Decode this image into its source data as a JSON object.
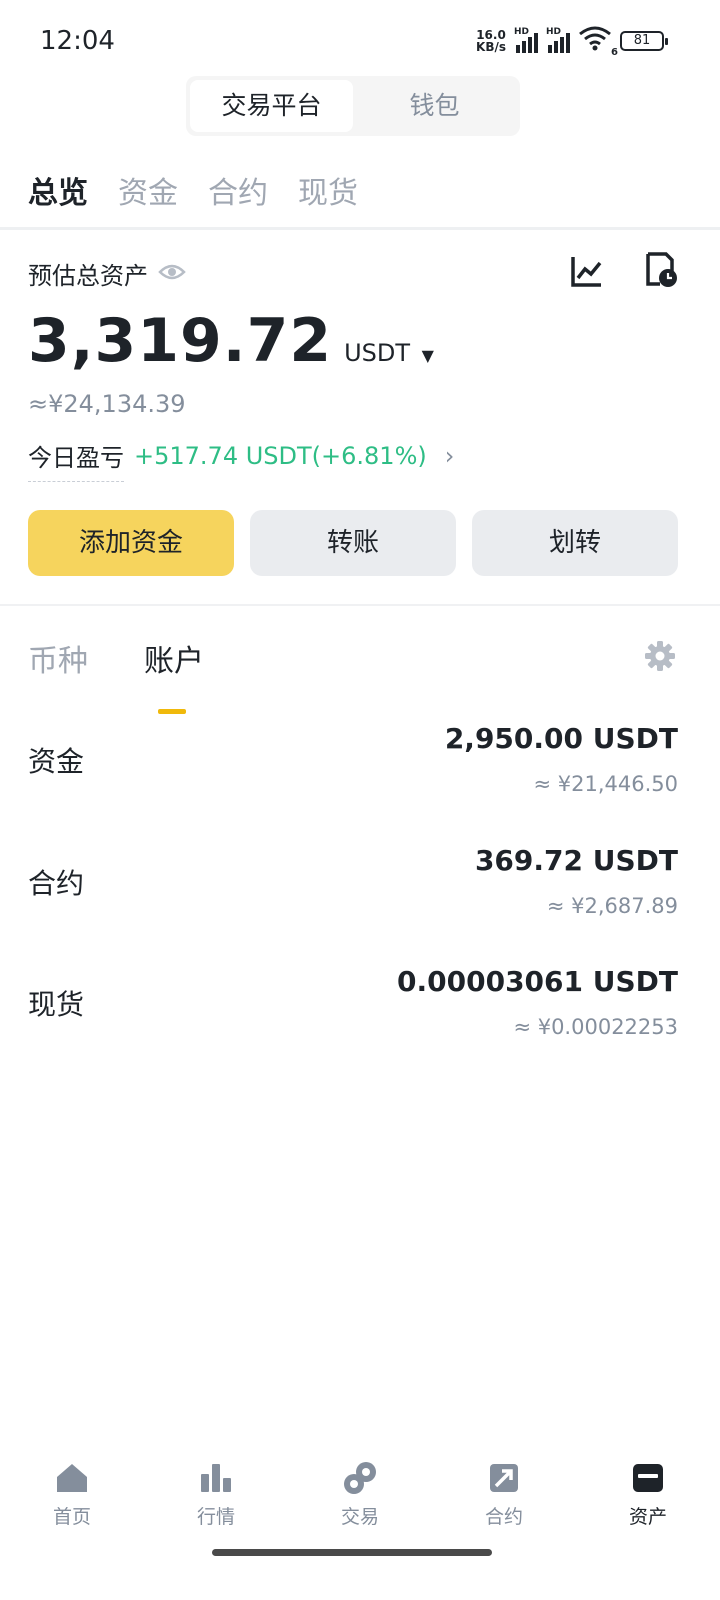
{
  "status_bar": {
    "time": "12:04",
    "net_speed_value": "16.0",
    "net_speed_unit": "KB/s",
    "hd": "HD",
    "wifi_badge": "6",
    "battery": "81"
  },
  "segment": {
    "items": [
      "交易平台",
      "钱包"
    ],
    "active": "交易平台"
  },
  "top_tabs": {
    "items": [
      "总览",
      "资金",
      "合约",
      "现货"
    ],
    "active": "总览"
  },
  "overview": {
    "label": "预估总资产",
    "balance": "3,319.72",
    "unit": "USDT",
    "fiat": "≈¥24,134.39",
    "pnl_label": "今日盈亏",
    "pnl_value": "+517.74 USDT(+6.81%)"
  },
  "actions": {
    "add_funds": "添加资金",
    "transfer": "转账",
    "internal_transfer": "划转"
  },
  "sub_tabs": {
    "items": [
      "币种",
      "账户"
    ],
    "active": "账户"
  },
  "accounts": [
    {
      "name": "资金",
      "value": "2,950.00 USDT",
      "fiat": "≈ ¥21,446.50"
    },
    {
      "name": "合约",
      "value": "369.72 USDT",
      "fiat": "≈ ¥2,687.89"
    },
    {
      "name": "现货",
      "value": "0.00003061 USDT",
      "fiat": "≈ ¥0.00022253"
    }
  ],
  "bottom_nav": {
    "items": [
      "首页",
      "行情",
      "交易",
      "合约",
      "资产"
    ],
    "active": "资产"
  },
  "colors": {
    "primary_yellow": "#f6d45d",
    "accent_yellow": "#f0b90b",
    "positive_green": "#2ebd85",
    "text_primary": "#1e2329",
    "text_secondary": "#848e9c"
  }
}
